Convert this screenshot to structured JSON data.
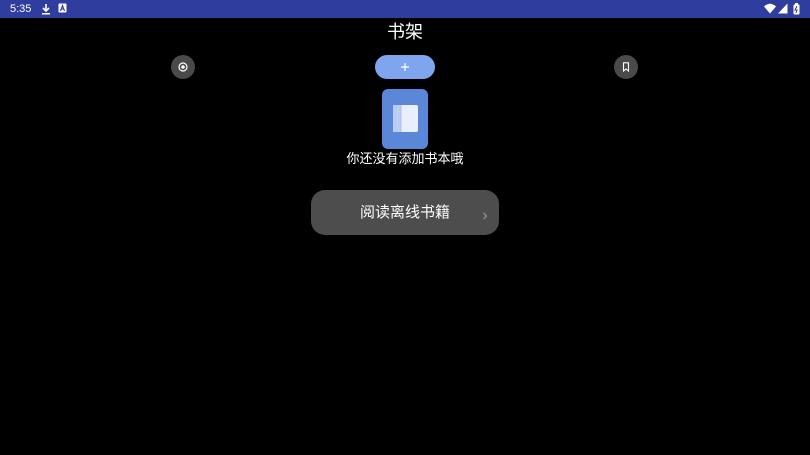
{
  "status_bar": {
    "time": "5:35",
    "left_icons": [
      "download-icon",
      "a-badge-icon"
    ],
    "right_icons": [
      "wifi-icon",
      "signal-icon",
      "battery-icon"
    ],
    "background": "#2f3e9e"
  },
  "header": {
    "title": "书架"
  },
  "toolbar": {
    "left_button_icon": "target-icon",
    "add_button_icon": "plus-icon",
    "right_button_icon": "bookmark-icon",
    "add_button_color": "#7fa5ee"
  },
  "empty_state": {
    "illustration_icon": "book-icon",
    "message": "你还没有添加书本哦",
    "illustration_color": "#5a87d8"
  },
  "read_offline": {
    "label": "阅读离线书籍",
    "icon": "chevron-right-icon"
  }
}
